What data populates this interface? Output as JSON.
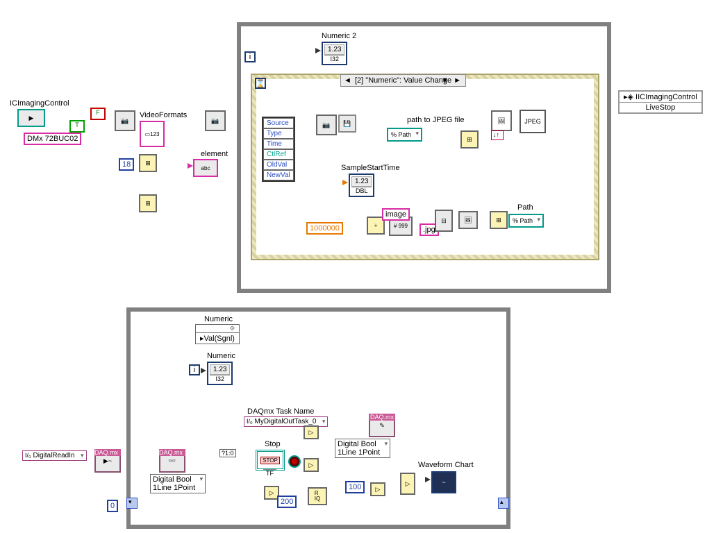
{
  "top": {
    "ic_label": "ICImagingControl",
    "device": "DMx 72BUC02",
    "videoformats": "VideoFormats",
    "element": "element",
    "eighteen": "18",
    "f": "F",
    "t": "T",
    "selector": "[2] \"Numeric\": Value Change",
    "cluster": {
      "c0": "Source",
      "c1": "Type",
      "c2": "Time",
      "c3": "CtlRef",
      "c4": "OldVal",
      "c5": "NewVal"
    },
    "numeric2": "Numeric 2",
    "iter": "i",
    "numericBox": "1.23",
    "sampleStart": "SampleStartTime",
    "sampleBox": "1.23",
    "million": "1000000",
    "pathToJpeg": "path to JPEG file",
    "pathIco": "% Path",
    "jpeg": "JPEG",
    "image": "image",
    "jpg": ".jpg",
    "path": "Path",
    "pathIco2": "% Path",
    "iic_out": "IICImagingControl",
    "livestop": "LiveStop",
    "divide": "÷",
    "mult": "×",
    "fmt999": "#\n999"
  },
  "bottom": {
    "numeric_top": "Numeric",
    "val_sgnl": "Val(Sgnl)",
    "numeric_ind": "Numeric",
    "numeric_val": "1.23",
    "iter": "i",
    "daq_task_lbl": "DAQmx Task Name",
    "daq_task": "MyDigitalOutTask_0",
    "daqmx_hdr": "DAQ.mx",
    "digital_read": "DigitalReadIn",
    "stop_lbl": "Stop",
    "stop_btn": "STOP",
    "stop_tf": "TF",
    "digital_bool": "Digital Bool\n1Line 1Point",
    "wave_chart": "Waveform Chart",
    "hundred": "100",
    "two_hundred": "200",
    "zero": "0",
    "q10": "?1:0",
    "r_iq": "R\nIQ"
  }
}
